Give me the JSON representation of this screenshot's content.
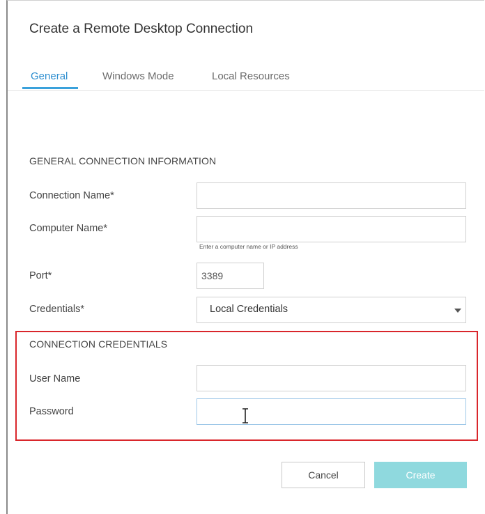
{
  "dialog": {
    "title": "Create a Remote Desktop Connection"
  },
  "tabs": [
    {
      "label": "General",
      "active": true
    },
    {
      "label": "Windows Mode",
      "active": false
    },
    {
      "label": "Local Resources",
      "active": false
    }
  ],
  "general": {
    "section_title": "GENERAL CONNECTION INFORMATION",
    "connection_name": {
      "label": "Connection Name*",
      "value": "",
      "placeholder": ""
    },
    "computer_name": {
      "label": "Computer Name*",
      "value": "",
      "placeholder": "",
      "hint": "Enter a computer name or IP address"
    },
    "port": {
      "label": "Port*",
      "value": "3389"
    },
    "credentials": {
      "label": "Credentials*",
      "selected": "Local Credentials"
    }
  },
  "connection_credentials": {
    "section_title": "CONNECTION CREDENTIALS",
    "user_name": {
      "label": "User Name",
      "value": ""
    },
    "password": {
      "label": "Password",
      "value": ""
    }
  },
  "footer": {
    "cancel_label": "Cancel",
    "create_label": "Create"
  },
  "colors": {
    "accent": "#3aa1db",
    "highlight_border": "#d9262b",
    "create_button": "#8fd9de"
  }
}
